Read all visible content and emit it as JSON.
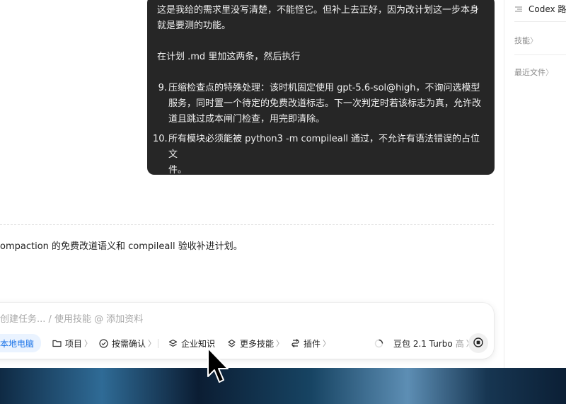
{
  "chat": {
    "user_message": {
      "line1": "这是我给的需求里没写清楚，不能怪它。但补上去正好，因为改计划这一步本身",
      "line2": "就是要测的功能。",
      "instruction": "在计划 .md 里加这两条，然后执行",
      "items": [
        {
          "num": "9.",
          "line1": "压缩检查点的特殊处理：该时机固定使用 gpt-5.6-sol@high，不询问选模型",
          "line2": "服务，同时置一个待定的免费改道标志。下一次判定时若该标志为真，允许改",
          "line3": "道且跳过成本闸门检查，用完即清除。"
        },
        {
          "num": "10.",
          "line1": "所有模块必须能被 python3 -m compileall 通过，不允许有语法错误的占位文",
          "line2": "件。"
        }
      ]
    },
    "assistant_reply": "ompaction 的免费改道语义和 compileall 验收补进计划。"
  },
  "composer": {
    "placeholder": "创建任务... / 使用技能 @ 添加资料",
    "chips": {
      "local": "本地电脑",
      "project": "项目",
      "confirm": "按需确认",
      "knowledge": "企业知识",
      "skills": "更多技能",
      "plugins": "插件"
    },
    "model": "豆包 2.1 Turbo",
    "model_level": "高"
  },
  "right_panel": {
    "title": "Codex 路",
    "skills": "技能",
    "recent_files": "最近文件"
  },
  "colors": {
    "bubble_bg": "#262626",
    "accent": "#1a73e8",
    "chip_local_bg": "#eaf3ff"
  },
  "icons": {
    "project": "folder-icon",
    "confirm": "check-circle-icon",
    "knowledge": "layers-icon",
    "skills": "stack-icon",
    "plugins": "plugin-icon",
    "model": "spinner-icon",
    "stop": "stop-icon",
    "panel": "list-icon"
  }
}
